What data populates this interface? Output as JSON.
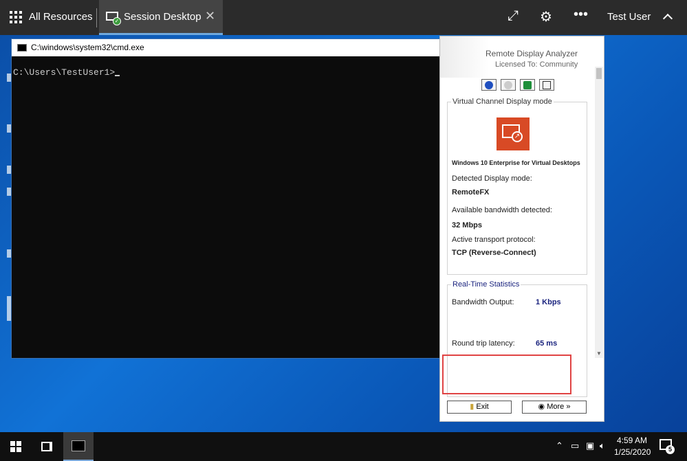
{
  "topbar": {
    "all_resources": "All Resources",
    "session_tab": "Session Desktop",
    "user": "Test User"
  },
  "cmd": {
    "title": "C:\\windows\\system32\\cmd.exe",
    "prompt": "C:\\Users\\TestUser1>"
  },
  "analyzer": {
    "app_name": "Remote Display Analyzer",
    "licensed": "Licensed To: Community",
    "vc_group_title": "Virtual Channel Display mode",
    "os_name": "Windows 10 Enterprise for Virtual Desktops",
    "detected_label": "Detected Display mode:",
    "detected_value": "RemoteFX",
    "bandwidth_label": "Available bandwidth detected:",
    "bandwidth_value": "32 Mbps",
    "transport_label": "Active transport protocol:",
    "transport_value": "TCP (Reverse-Connect)",
    "rt_group_title": "Real-Time Statistics",
    "bw_output_label": "Bandwidth Output:",
    "bw_output_value": "1 Kbps",
    "latency_label": "Round trip latency:",
    "latency_value": "65 ms",
    "exit_label": "Exit",
    "more_label": "More"
  },
  "taskbar": {
    "time": "4:59 AM",
    "date": "1/25/2020",
    "notification_count": "5"
  },
  "colors": {
    "topbar_bg": "#2b2b2b",
    "tile_orange": "#d84a25",
    "highlight_red": "#e04343",
    "value_blue": "#1a237e"
  }
}
